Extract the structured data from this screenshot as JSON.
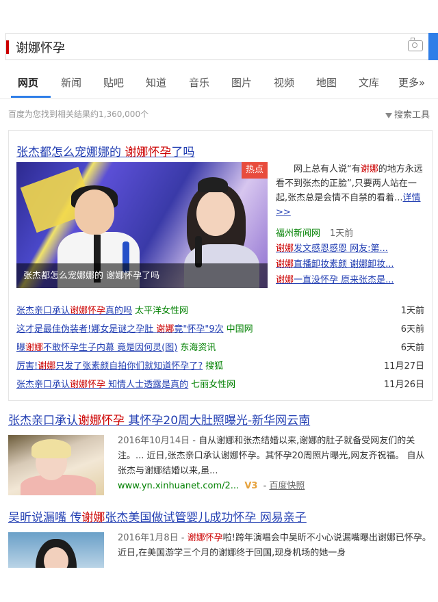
{
  "search": {
    "query": "谢娜怀孕"
  },
  "tabs": [
    "网页",
    "新闻",
    "贴吧",
    "知道",
    "音乐",
    "图片",
    "视频",
    "地图",
    "文库",
    "更多»"
  ],
  "result_count": "百度为您找到相关结果约1,360,000个",
  "tools_label": "搜索工具",
  "news_card": {
    "title_pre": "张杰都怎么宠娜娜的 ",
    "title_hl": "谢娜怀孕",
    "title_post": "了吗",
    "hot_badge": "热点",
    "image_caption": "张杰都怎么宠娜娜的 谢娜怀孕了吗",
    "summary_1": "网上总有人说“有",
    "summary_hl": "谢娜",
    "summary_2": "的地方永远看不到张杰的正脸”,只要两人站在一起,张杰总是会情不自禁的看着...",
    "more_link": "详情>>",
    "source": "福州新闻网",
    "time": "1天前",
    "related": [
      {
        "hl": "谢娜",
        "rest": "发文感恩感恩 网友:第..."
      },
      {
        "hl": "谢娜",
        "rest": "直播卸妆素颜 谢娜卸妆..."
      },
      {
        "hl": "谢娜",
        "rest": "一直没怀孕 原来张杰是..."
      }
    ],
    "list": [
      {
        "pre": "张杰亲口承认",
        "hl": "谢娜怀孕",
        "post": "真的吗",
        "src": "太平洋女性网",
        "date": "1天前"
      },
      {
        "pre": "这才是最佳伪装者!娜女是谜之孕肚 ",
        "hl": "谢娜",
        "post": "竟\"怀孕\"9次",
        "src": "中国网",
        "date": "6天前"
      },
      {
        "pre": "曝",
        "hl": "谢娜",
        "post": "不敢怀孕生子内幕 竟是因何灵(图)",
        "src": "东海资讯",
        "date": "6天前"
      },
      {
        "pre": "厉害!",
        "hl": "谢娜",
        "post": "只发了张素颜自拍你们就知道怀孕了?",
        "src": "搜狐",
        "date": "11月27日"
      },
      {
        "pre": "张杰亲口承认",
        "hl": "谢娜怀孕",
        "post": " 知情人士透露是真的",
        "src": "七丽女性网",
        "date": "11月26日"
      }
    ]
  },
  "results": [
    {
      "title_pre": "张杰亲口承认",
      "title_hl": "谢娜怀孕",
      "title_post": " 其怀孕20周大肚照曝光-新华网云南",
      "date": "2016年10月14日",
      "snippet": " - 自从谢娜和张杰结婚以来,谢娜的肚子就备受网友们的关注。... 近日,张杰亲口承认谢娜怀孕。其怀孕20周照片曝光,网友齐祝福。 自从张杰与谢娜结婚以来,虽...",
      "url": "www.yn.xinhuanet.com/2...",
      "v_badge": "V3",
      "cache": "百度快照"
    },
    {
      "title_pre": "吴昕说漏嘴 传",
      "title_hl": "谢娜",
      "title_post": "张杰美国做试管婴儿成功怀孕 网易亲子",
      "date": "2016年1月8日",
      "snippet_hl": "谢娜怀孕",
      "snippet": "啦!跨年演唱会中吴昕不小心说漏嘴曝出谢娜已怀孕。近日,在美国游学三个月的谢娜终于回国,现身机场的她一身"
    }
  ]
}
